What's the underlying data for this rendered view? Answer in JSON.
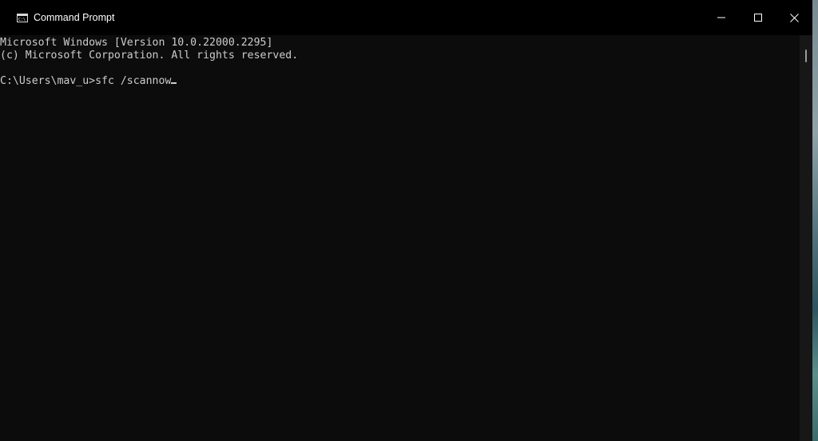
{
  "window": {
    "title": "Command Prompt",
    "icon": "cmd-icon"
  },
  "controls": {
    "minimize_icon": "minimize-icon",
    "maximize_icon": "maximize-icon",
    "close_icon": "close-icon"
  },
  "console": {
    "lines": [
      "Microsoft Windows [Version 10.0.22000.2295]",
      "(c) Microsoft Corporation. All rights reserved."
    ],
    "prompt": "C:\\Users\\mav_u>",
    "command": "sfc /scannow"
  },
  "colors": {
    "titlebar": "#000000",
    "background": "#0c0c0c",
    "text": "#cccccc"
  }
}
